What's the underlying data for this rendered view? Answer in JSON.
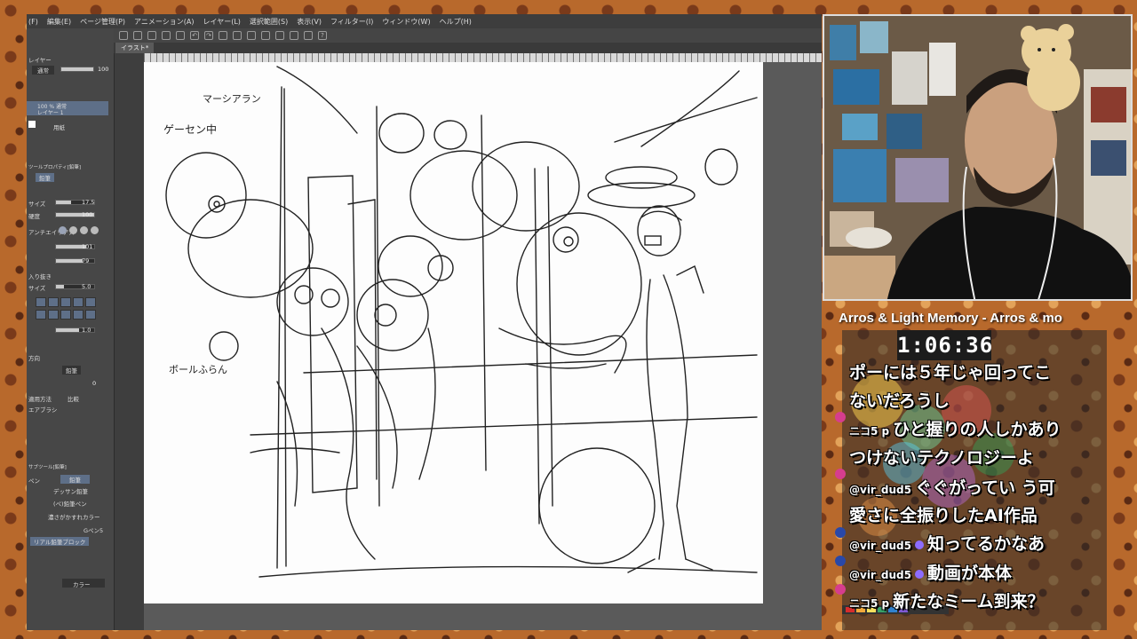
{
  "menu": {
    "items": [
      "(F)",
      "編集(E)",
      "ページ管理(P)",
      "アニメーション(A)",
      "レイヤー(L)",
      "選択範囲(S)",
      "表示(V)",
      "フィルター(I)",
      "ウィンドウ(W)",
      "ヘルプ(H)"
    ]
  },
  "canvas_tab": {
    "label": "イラスト*"
  },
  "left_panel": {
    "layer_label": "レイヤー",
    "blend_mode": "通常",
    "opacity": "100",
    "layer1_name": "100 % 通常",
    "layer1_sub": "レイヤー 1",
    "layer2_name": "用紙",
    "tool_header": "ツールプロパティ[鉛筆]",
    "tool_name": "鉛筆",
    "size_label": "サイズ",
    "size_value": "17.5",
    "density_label": "硬度",
    "density_value": "100",
    "aa_label": "アンチエイリアス",
    "value_101": "101",
    "value_79": "79",
    "interval_label": "入り抜き",
    "size2_label": "サイズ",
    "size2_value": "5.0",
    "value_10": "1.0",
    "direction_label": "方向",
    "pencil_label": "鉛筆",
    "zero_value": "0",
    "apply_label": "適用方法",
    "apply_value": "比較",
    "brush_label": "エアブラシ",
    "subtool_header": "サブツール[鉛筆]",
    "subtool_tab1": "ペン",
    "subtool_tab2": "鉛筆",
    "subtools": [
      "デッサン鉛筆",
      "(ペ)鉛筆ペン",
      "濃さがかすれカラー",
      "Gペン5",
      "リアル鉛筆ブロック"
    ],
    "color_label": "カラー"
  },
  "sketch_texts": {
    "t1": "マーシアラン",
    "t2": "ゲーセン中",
    "t3": "ボールふらん"
  },
  "stream": {
    "title": "Arros & Light Memory - Arros & mo",
    "timer": "1:06:36"
  },
  "chat": [
    {
      "user": "",
      "message": "ポーには５年じゃ回ってこ"
    },
    {
      "user": "",
      "message": "ないだろうし"
    },
    {
      "user": "ニコ5 p",
      "message": "ひと握りの人しかあり"
    },
    {
      "user": "",
      "message": "つけないテクノロジーよ"
    },
    {
      "user": "@vir_dud5",
      "message": "ぐぐがってい う可"
    },
    {
      "user": "",
      "message": "愛さに全振りしたAI作品"
    },
    {
      "user": "@vir_dud5",
      "message": "知ってるかなあ"
    },
    {
      "user": "@vir_dud5",
      "message": "動画が本体"
    },
    {
      "user": "ニコ5 p",
      "message": "新たなミーム到来？"
    }
  ],
  "colors": {
    "accent": "#5e6f88",
    "panel": "#474747",
    "canvas_bg": "#5a5a5a",
    "timer_bg": "#1c1c1c"
  }
}
